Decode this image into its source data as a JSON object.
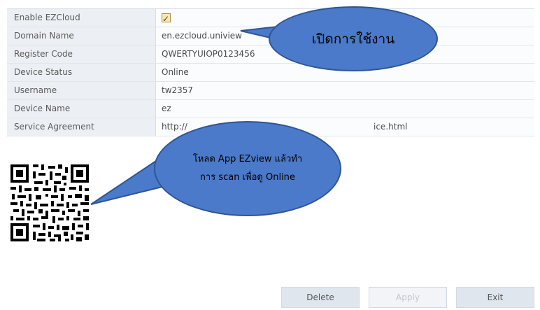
{
  "rows": [
    {
      "label": "Enable EZCloud",
      "value": "",
      "checked": true
    },
    {
      "label": "Domain Name",
      "value": "en.ezcloud.uniview"
    },
    {
      "label": "Register Code",
      "value": "QWERTYUIOP0123456"
    },
    {
      "label": "Device Status",
      "value": "Online"
    },
    {
      "label": "Username",
      "value": "tw2357"
    },
    {
      "label": "Device Name",
      "value": "ez"
    },
    {
      "label": "Service Agreement",
      "value": "http://",
      "value_end": "ice.html"
    }
  ],
  "callouts": {
    "enable": "เปิดการใช้งาน",
    "scan_line1": "โหลด App EZview แล้วทำ",
    "scan_line2": "การ scan เพื่อดู Online"
  },
  "buttons": {
    "delete": "Delete",
    "apply": "Apply",
    "exit": "Exit"
  },
  "colors": {
    "callout_fill": "#4a7ac9",
    "callout_border": "#2f5596",
    "checkbox_fill": "#f6e7b8"
  },
  "icons": {
    "qr": "qr-code-icon",
    "checkbox": "checkbox-icon"
  }
}
